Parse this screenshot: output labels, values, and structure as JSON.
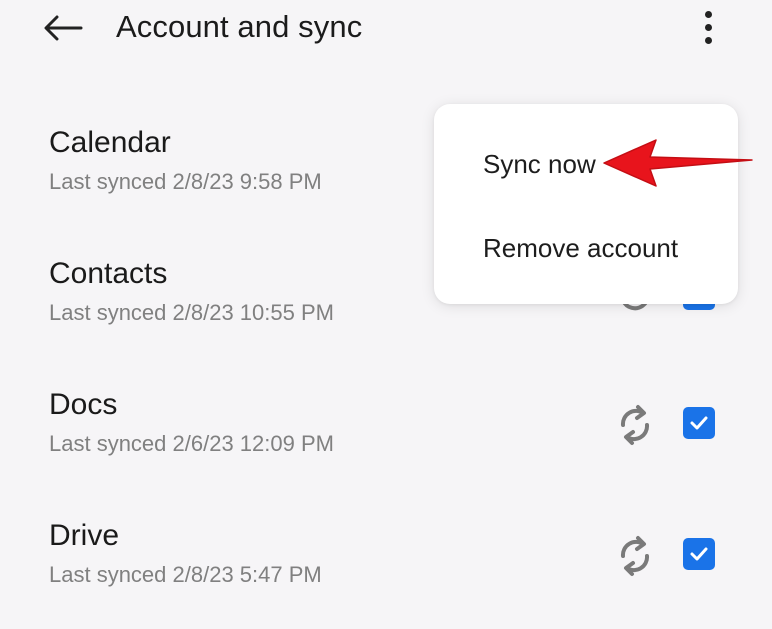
{
  "header": {
    "back_icon": "arrow-left-icon",
    "title": "Account and sync",
    "more_icon": "more-vertical-icon"
  },
  "accounts": [
    {
      "name": "Calendar",
      "status": "Last synced 2/8/23 9:58 PM",
      "checked": true
    },
    {
      "name": "Contacts",
      "status": "Last synced 2/8/23 10:55 PM",
      "checked": true
    },
    {
      "name": "Docs",
      "status": "Last synced 2/6/23 12:09 PM",
      "checked": true
    },
    {
      "name": "Drive",
      "status": "Last synced 2/8/23 5:47 PM",
      "checked": true
    }
  ],
  "menu": {
    "items": [
      {
        "label": "Sync now"
      },
      {
        "label": "Remove account"
      }
    ]
  },
  "colors": {
    "accent": "#1a73e8",
    "annotation_arrow": "#e8141c",
    "background": "#f6f5f7"
  }
}
